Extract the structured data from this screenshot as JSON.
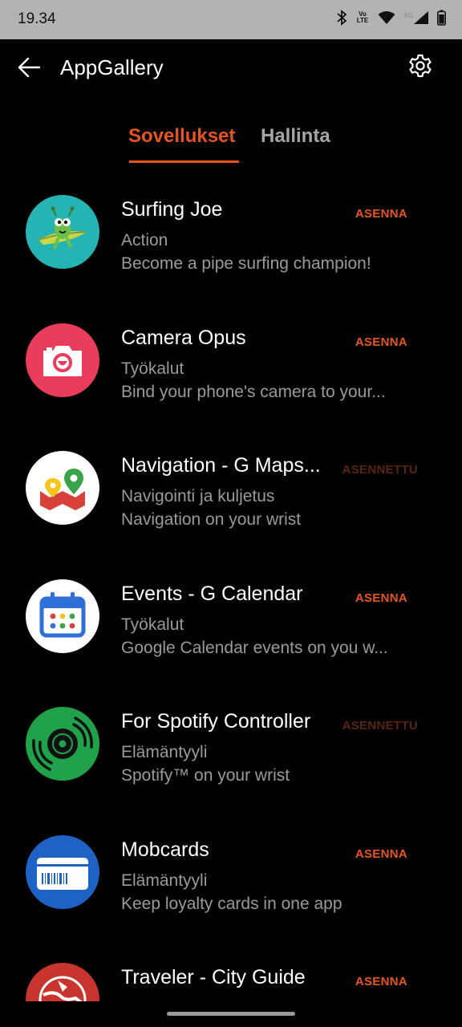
{
  "status": {
    "time": "19.34",
    "volte": "Vo LTE",
    "network": "4G"
  },
  "header": {
    "title": "AppGallery"
  },
  "tabs": [
    {
      "label": "Sovellukset",
      "active": true
    },
    {
      "label": "Hallinta",
      "active": false
    }
  ],
  "apps": [
    {
      "name": "Surfing Joe",
      "category": "Action",
      "description": "Become a pipe surfing champion!",
      "action": "ASENNA",
      "icon": "surfing-joe-icon"
    },
    {
      "name": "Camera Opus",
      "category": "Työkalut",
      "description": "Bind your phone's camera to your...",
      "action": "ASENNA",
      "icon": "camera-icon"
    },
    {
      "name": "Navigation - G Maps...",
      "category": "Navigointi ja kuljetus",
      "description": "Navigation on your wrist",
      "action": "ASENNETTU",
      "icon": "maps-icon"
    },
    {
      "name": "Events - G Calendar",
      "category": "Työkalut",
      "description": "Google Calendar events on you w...",
      "action": "ASENNA",
      "icon": "calendar-icon"
    },
    {
      "name": "For Spotify Controller",
      "category": "Elämäntyyli",
      "description": "Spotify™ on your wrist",
      "action": "ASENNETTU",
      "icon": "spotify-icon"
    },
    {
      "name": "Mobcards",
      "category": "Elämäntyyli",
      "description": "Keep loyalty cards in one app",
      "action": "ASENNA",
      "icon": "loyalty-card-icon"
    },
    {
      "name": "Traveler - City Guide",
      "category": "",
      "description": "",
      "action": "ASENNA",
      "icon": "traveler-icon"
    }
  ],
  "colors": {
    "accent": "#e8541e",
    "installed": "#5a2410",
    "background": "#000000",
    "statusbar": "#b3b3b3"
  }
}
